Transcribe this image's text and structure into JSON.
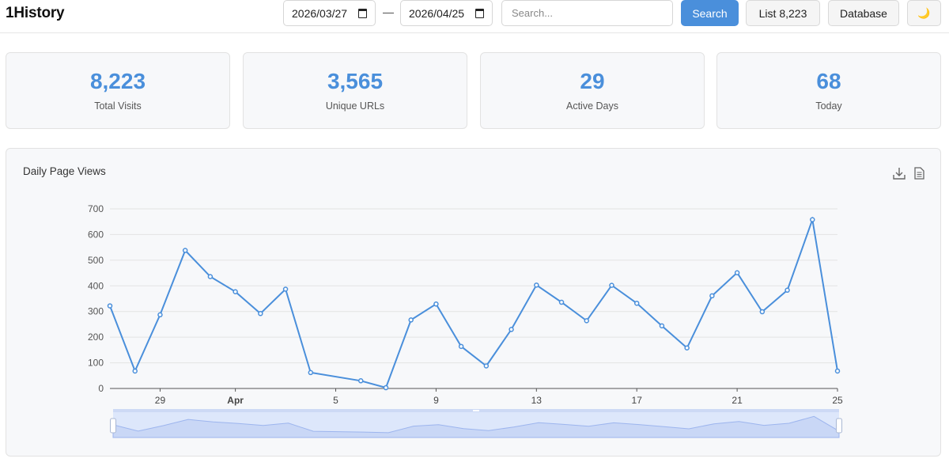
{
  "app": {
    "title": "1History"
  },
  "toolbar": {
    "start_date": "2026/03/27",
    "end_date": "2026/04/25",
    "separator": "—",
    "search_placeholder": "Search...",
    "search_label": "Search",
    "list_label": "List 8,223",
    "database_label": "Database",
    "theme_icon": "🌙"
  },
  "stats": [
    {
      "value": "8,223",
      "label": "Total Visits"
    },
    {
      "value": "3,565",
      "label": "Unique URLs"
    },
    {
      "value": "29",
      "label": "Active Days"
    },
    {
      "value": "68",
      "label": "Today"
    }
  ],
  "colors": {
    "accent": "#4a8fdb",
    "zoom_fill": "#dde7fb",
    "zoom_line": "#9db5ee"
  },
  "icons": {
    "download": "download-icon",
    "data_view": "document-icon"
  },
  "chart_data": {
    "type": "line",
    "title": "Daily Page Views",
    "xlabel": "",
    "ylabel": "",
    "ylim": [
      0,
      700
    ],
    "yticks": [
      "0",
      "100",
      "200",
      "300",
      "400",
      "500",
      "600",
      "700"
    ],
    "xticks": [
      {
        "label": "29",
        "date": "2026/03/29",
        "bold": false
      },
      {
        "label": "Apr",
        "date": "2026/04/01",
        "bold": true
      },
      {
        "label": "5",
        "date": "2026/04/05",
        "bold": false
      },
      {
        "label": "9",
        "date": "2026/04/09",
        "bold": false
      },
      {
        "label": "13",
        "date": "2026/04/13",
        "bold": false
      },
      {
        "label": "17",
        "date": "2026/04/17",
        "bold": false
      },
      {
        "label": "21",
        "date": "2026/04/21",
        "bold": false
      },
      {
        "label": "25",
        "date": "2026/04/25",
        "bold": false
      }
    ],
    "grid": true,
    "series": [
      {
        "points": [
          {
            "x": "2026/03/27",
            "y": 322
          },
          {
            "x": "2026/03/28",
            "y": 68
          },
          {
            "x": "2026/03/29",
            "y": 287
          },
          {
            "x": "2026/03/30",
            "y": 538
          },
          {
            "x": "2026/03/31",
            "y": 436
          },
          {
            "x": "2026/04/01",
            "y": 377
          },
          {
            "x": "2026/04/02",
            "y": 292
          },
          {
            "x": "2026/04/03",
            "y": 387
          },
          {
            "x": "2026/04/04",
            "y": 62
          },
          {
            "x": "2026/04/06",
            "y": 30
          },
          {
            "x": "2026/04/07",
            "y": 3
          },
          {
            "x": "2026/04/08",
            "y": 267
          },
          {
            "x": "2026/04/09",
            "y": 329
          },
          {
            "x": "2026/04/10",
            "y": 164
          },
          {
            "x": "2026/04/11",
            "y": 88
          },
          {
            "x": "2026/04/12",
            "y": 230
          },
          {
            "x": "2026/04/13",
            "y": 403
          },
          {
            "x": "2026/04/14",
            "y": 336
          },
          {
            "x": "2026/04/15",
            "y": 264
          },
          {
            "x": "2026/04/16",
            "y": 402
          },
          {
            "x": "2026/04/17",
            "y": 332
          },
          {
            "x": "2026/04/18",
            "y": 244
          },
          {
            "x": "2026/04/19",
            "y": 158
          },
          {
            "x": "2026/04/20",
            "y": 361
          },
          {
            "x": "2026/04/21",
            "y": 451
          },
          {
            "x": "2026/04/22",
            "y": 299
          },
          {
            "x": "2026/04/23",
            "y": 383
          },
          {
            "x": "2026/04/24",
            "y": 658
          },
          {
            "x": "2026/04/25",
            "y": 68
          }
        ]
      }
    ],
    "zoom": {
      "start": 0,
      "end": 1
    }
  }
}
